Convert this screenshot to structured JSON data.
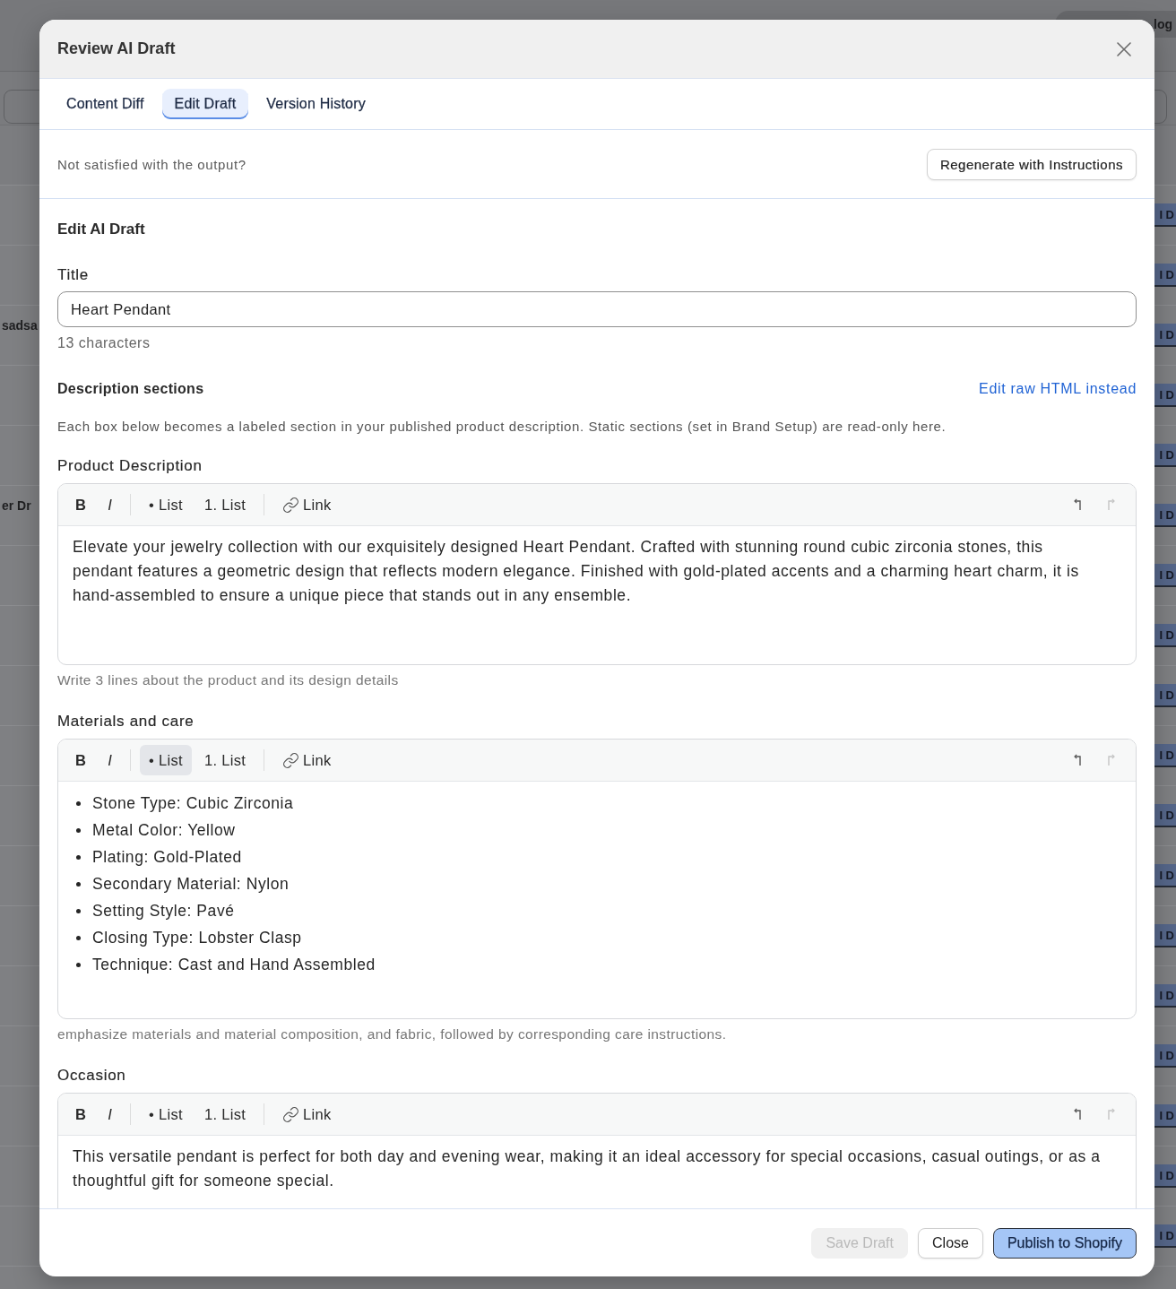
{
  "background_page": {
    "top_button": "log",
    "rows": [
      {
        "badge": "I D"
      },
      {
        "badge": "I D"
      },
      {
        "name": "sadsa",
        "badge": "I D"
      },
      {
        "badge": "I D"
      },
      {
        "badge": "I D"
      },
      {
        "name": "er Dr",
        "badge": "I D"
      },
      {
        "badge": "I D"
      },
      {
        "badge": "I D"
      },
      {
        "badge": "I D"
      },
      {
        "badge": "I D"
      },
      {
        "badge": "I D"
      },
      {
        "badge": "I D"
      },
      {
        "badge": "I D"
      },
      {
        "badge": "I D"
      },
      {
        "badge": "I D"
      },
      {
        "badge": "I D"
      },
      {
        "badge": "I D"
      },
      {
        "badge": "I D"
      }
    ]
  },
  "dialog": {
    "title": "Review AI Draft"
  },
  "tabs": [
    {
      "label": "Content Diff",
      "selected": false
    },
    {
      "label": "Edit Draft",
      "selected": true
    },
    {
      "label": "Version History",
      "selected": false
    }
  ],
  "regenerate": {
    "prompt": "Not satisfied with the output?",
    "button": "Regenerate with Instructions"
  },
  "edit_draft": {
    "heading": "Edit AI Draft",
    "title_field": {
      "label": "Title",
      "value": "Heart Pendant",
      "counter": "13 characters"
    },
    "description": {
      "heading": "Description sections",
      "link": "Edit raw HTML instead",
      "note": "Each box below becomes a labeled section in your published product description. Static sections (set in Brand Setup) are read-only here."
    },
    "sections": [
      {
        "label": "Product Description",
        "toolbar": [
          {
            "kind": "bold",
            "label": "B",
            "active": false
          },
          {
            "kind": "italic",
            "label": "I",
            "active": false
          },
          {
            "kind": "divider"
          },
          {
            "kind": "bullet_list",
            "label": "• List",
            "active": false
          },
          {
            "kind": "numbered_list",
            "label": "1. List",
            "active": false
          },
          {
            "kind": "divider"
          },
          {
            "kind": "link",
            "label": "Link",
            "active": false
          }
        ],
        "history": [
          {
            "kind": "undo",
            "disabled": false
          },
          {
            "kind": "redo",
            "disabled": true
          }
        ],
        "content": {
          "kind": "paragraph",
          "text": "Elevate your jewelry collection with our exquisitely designed Heart Pendant. Crafted with stunning round cubic zirconia stones, this pendant features a geometric design that reflects modern elegance. Finished with gold-plated accents and a charming heart charm, it is hand-assembled to ensure a unique piece that stands out in any ensemble."
        },
        "hint": "Write 3 lines about the product and its design details"
      },
      {
        "label": "Materials and care",
        "toolbar": [
          {
            "kind": "bold",
            "label": "B",
            "active": false
          },
          {
            "kind": "italic",
            "label": "I",
            "active": false
          },
          {
            "kind": "divider"
          },
          {
            "kind": "bullet_list",
            "label": "• List",
            "active": true
          },
          {
            "kind": "numbered_list",
            "label": "1. List",
            "active": false
          },
          {
            "kind": "divider"
          },
          {
            "kind": "link",
            "label": "Link",
            "active": false
          }
        ],
        "history": [
          {
            "kind": "undo",
            "disabled": false
          },
          {
            "kind": "redo",
            "disabled": true
          }
        ],
        "content": {
          "kind": "bullets",
          "items": [
            "Stone Type: Cubic Zirconia",
            "Metal Color: Yellow",
            "Plating: Gold-Plated",
            "Secondary Material: Nylon",
            "Setting Style: Pavé",
            "Closing Type: Lobster Clasp",
            "Technique: Cast and Hand Assembled"
          ]
        },
        "hint": "emphasize materials and material composition, and fabric, followed by corresponding care instructions."
      },
      {
        "label": "Occasion",
        "toolbar": [
          {
            "kind": "bold",
            "label": "B",
            "active": false
          },
          {
            "kind": "italic",
            "label": "I",
            "active": false
          },
          {
            "kind": "divider"
          },
          {
            "kind": "bullet_list",
            "label": "• List",
            "active": false
          },
          {
            "kind": "numbered_list",
            "label": "1. List",
            "active": false
          },
          {
            "kind": "divider"
          },
          {
            "kind": "link",
            "label": "Link",
            "active": false
          }
        ],
        "history": [
          {
            "kind": "undo",
            "disabled": false
          },
          {
            "kind": "redo",
            "disabled": true
          }
        ],
        "content": {
          "kind": "paragraph",
          "text": "This versatile pendant is perfect for both day and evening wear, making it an ideal accessory for special occasions, casual outings, or as a thoughtful gift for someone special."
        }
      }
    ]
  },
  "footer": {
    "buttons": [
      {
        "label": "Save Draft",
        "kind": "secondary",
        "disabled": true
      },
      {
        "label": "Close",
        "kind": "secondary",
        "disabled": false
      },
      {
        "label": "Publish to Shopify",
        "kind": "primary",
        "disabled": false
      }
    ]
  }
}
